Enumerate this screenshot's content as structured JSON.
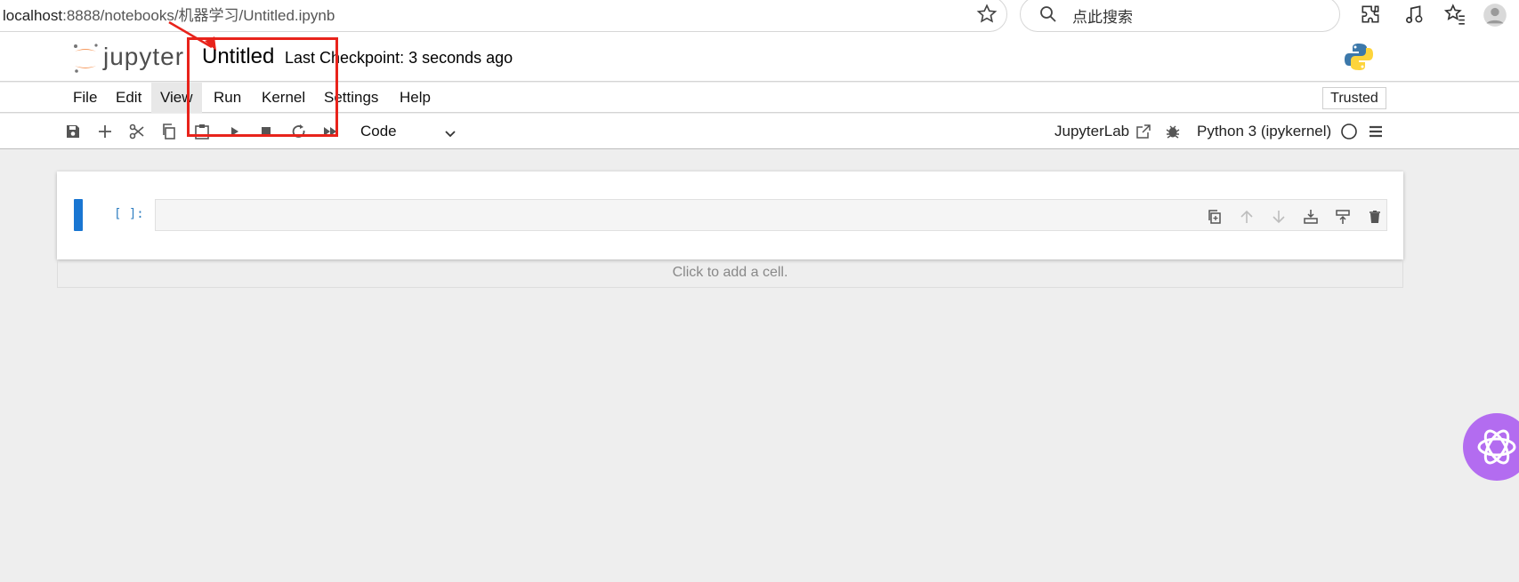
{
  "browser": {
    "url_host": "localhost",
    "url_path": ":8888/notebooks/机器学习/Untitled.ipynb",
    "search_placeholder": "点此搜索"
  },
  "header": {
    "logo_text": "jupyter",
    "notebook_title": "Untitled",
    "checkpoint": "Last Checkpoint: 3 seconds ago"
  },
  "menu": {
    "items": [
      "File",
      "Edit",
      "View",
      "Run",
      "Kernel",
      "Settings",
      "Help"
    ],
    "active": "View",
    "trusted": "Trusted"
  },
  "toolbar": {
    "cell_type": "Code",
    "jupyterlab_label": "JupyterLab",
    "kernel": "Python 3 (ipykernel)"
  },
  "notebook": {
    "prompt": "[ ]:",
    "add_cell_hint": "Click to add a cell."
  },
  "colors": {
    "accent": "#1976d2",
    "annotation": "#e8231b",
    "jupyter_orange": "#f37726"
  }
}
